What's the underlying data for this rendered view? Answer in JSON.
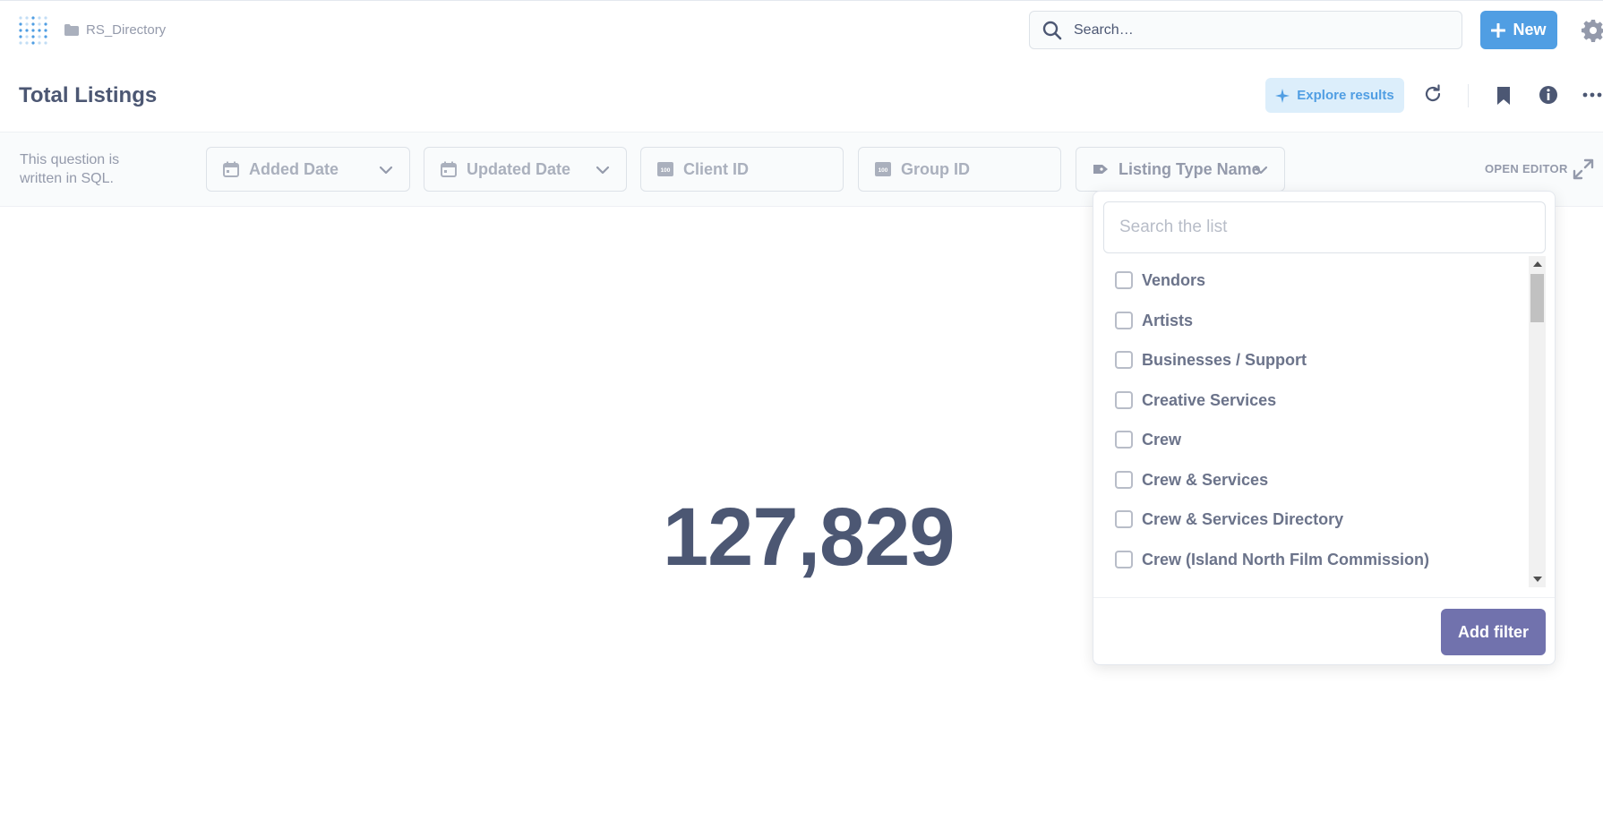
{
  "nav": {
    "breadcrumb": "RS_Directory",
    "search_label": "Search…",
    "new_label": "New"
  },
  "header": {
    "title": "Total Listings",
    "explore_label": "Explore results"
  },
  "filterbar": {
    "sql_note": "This question is written in SQL.",
    "filters": [
      {
        "label": "Added Date",
        "icon": "calendar-icon"
      },
      {
        "label": "Updated Date",
        "icon": "calendar-icon"
      },
      {
        "label": "Client ID",
        "icon": "number-icon"
      },
      {
        "label": "Group ID",
        "icon": "number-icon"
      },
      {
        "label": "Listing Type Name",
        "icon": "tag-icon"
      }
    ],
    "open_editor": "OPEN EDITOR"
  },
  "result": {
    "value": "127,829"
  },
  "popover": {
    "search_placeholder": "Search the list",
    "options": [
      "Vendors",
      "Artists",
      "Businesses / Support",
      "Creative Services",
      "Crew",
      "Crew & Services",
      "Crew & Services Directory",
      "Crew (Island North Film Commission)"
    ],
    "add_filter_label": "Add filter"
  },
  "colors": {
    "brand": "#509ee3",
    "filter_accent": "#7172ad",
    "text": "#4c5773"
  }
}
